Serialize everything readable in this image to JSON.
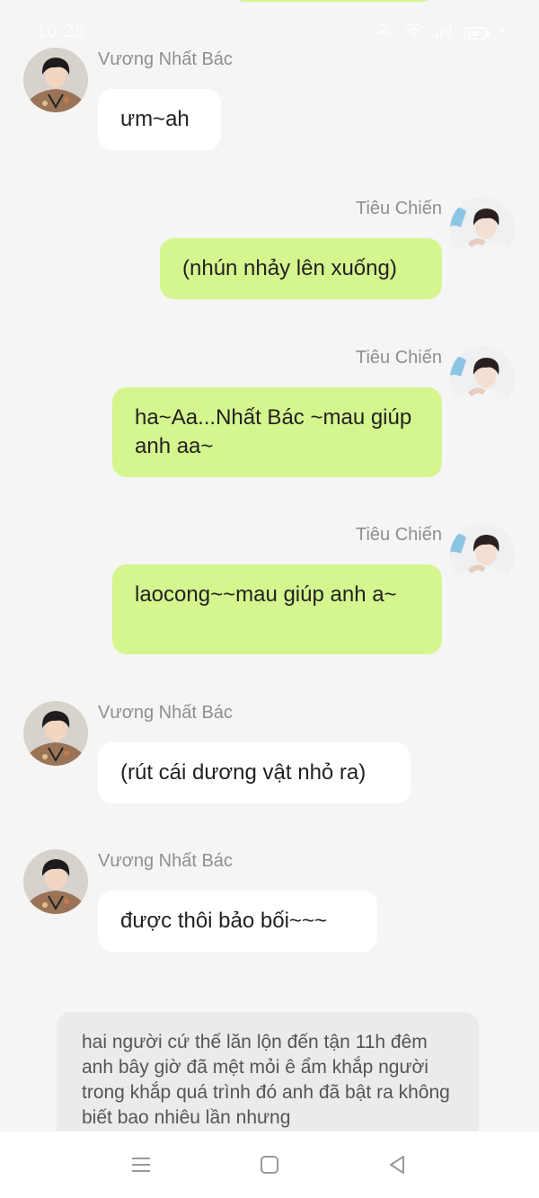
{
  "status_bar": {
    "time": "10:25",
    "battery_level": 0.7
  },
  "messages": [
    {
      "sender": "Vương Nhất Bác",
      "text": "ưm~ah",
      "side": "left"
    },
    {
      "sender": "Tiêu Chiến",
      "text": "(nhún nhảy lên xuống)",
      "side": "right"
    },
    {
      "sender": "Tiêu Chiến",
      "text": "ha~Aa...Nhất Bác ~mau giúp anh aa~",
      "side": "right"
    },
    {
      "sender": "Tiêu Chiến",
      "text": "laocong~~mau giúp anh a~",
      "side": "right"
    },
    {
      "sender": "Vương Nhất Bác",
      "text": "(rút cái dương vật nhỏ ra)",
      "side": "left"
    },
    {
      "sender": "Vương Nhất Bác",
      "text": "được thôi bảo bối~~~",
      "side": "left"
    }
  ],
  "narration": {
    "text": "hai người cứ thế lăn lộn đến tận 11h đêm anh bây giờ đã mệt mỏi ê ẩm khắp người trong khắp quá trình đó anh đã bật ra không biết bao nhiêu lần nhưng"
  },
  "nav_bar": {
    "icons": [
      "menu-icon",
      "home-square-icon",
      "back-triangle-icon"
    ]
  },
  "colors": {
    "background": "#f5f5f5",
    "bubble_green": "#d5f58e",
    "bubble_white": "#ffffff",
    "narration_bg": "#ebebeb",
    "sender_name": "#8f8f8f"
  }
}
